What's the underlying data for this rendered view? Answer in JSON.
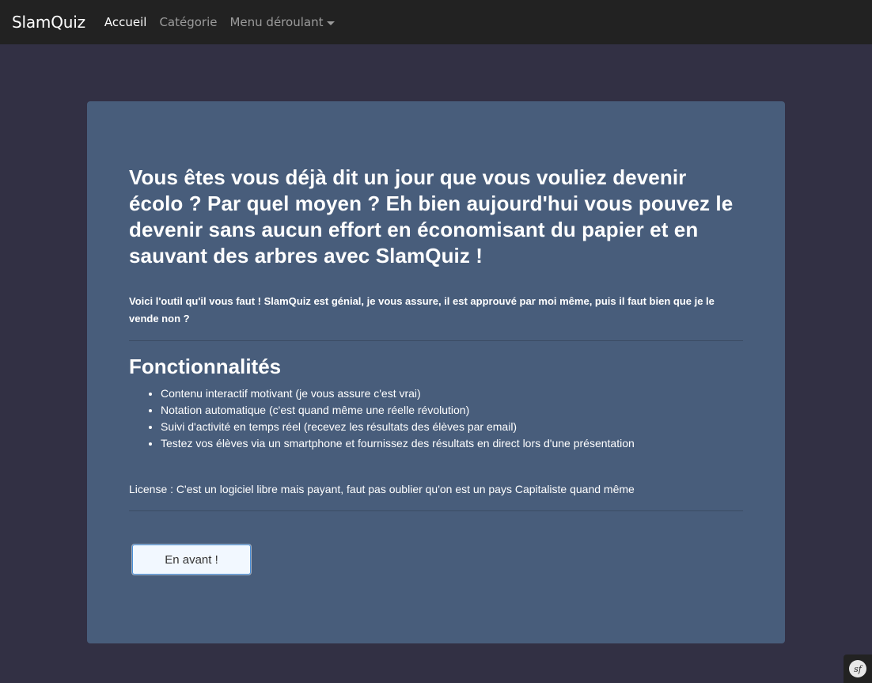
{
  "navbar": {
    "brand": "SlamQuiz",
    "links": [
      {
        "label": "Accueil",
        "active": true
      },
      {
        "label": "Catégorie",
        "active": false
      },
      {
        "label": "Menu déroulant",
        "active": false,
        "dropdown": true
      }
    ]
  },
  "jumbotron": {
    "title": "Vous êtes vous déjà dit un jour que vous vouliez devenir écolo ? Par quel moyen ? Eh bien aujourd'hui vous pouvez le devenir sans aucun effort en économisant du papier et en sauvant des arbres avec SlamQuiz !",
    "lead": "Voici l'outil qu'il vous faut ! SlamQuiz est génial, je vous assure, il est approuvé par moi même, puis il faut bien que je le vende non ?",
    "features_title": "Fonctionnalités",
    "features": [
      "Contenu interactif motivant (je vous assure c'est vrai)",
      "Notation automatique (c'est quand même une réelle révolution)",
      "Suivi d'activité en temps réel (recevez les résultats des élèves par email)",
      "Testez vos élèves via un smartphone et fournissez des résultats en direct lors d'une présentation"
    ],
    "license": "License : C'est un logiciel libre mais payant, faut pas oublier qu'on est un pays Capitaliste quand même",
    "cta_label": "En avant !"
  },
  "debug_toolbar": {
    "icon": "symfony-icon",
    "logo_text": "sf"
  },
  "colors": {
    "page_bg": "#323044",
    "navbar_bg": "#222222",
    "jumbotron_bg": "#485d7b",
    "button_bg": "#f2f8ff",
    "button_border": "#4a90d9"
  }
}
